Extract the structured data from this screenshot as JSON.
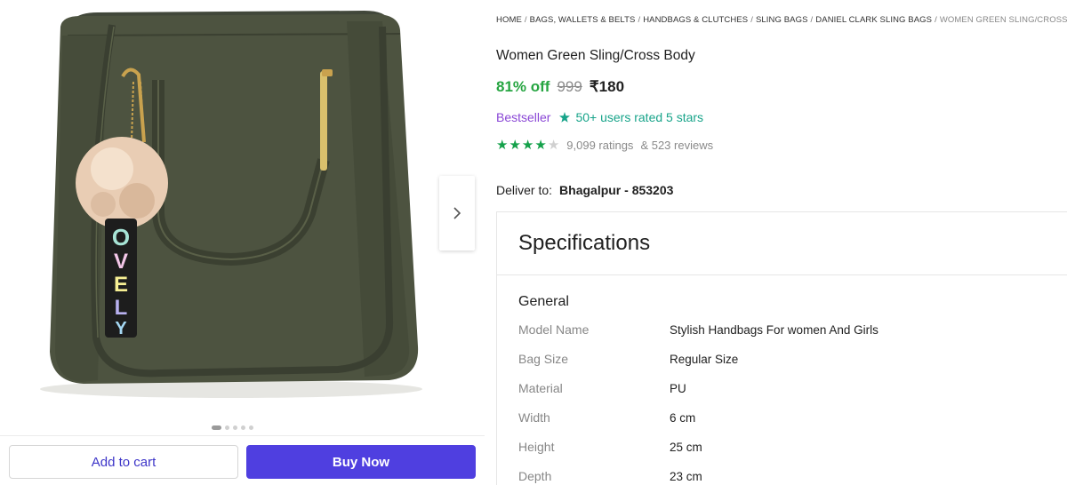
{
  "gallery": {
    "product_image_alt": "Women Green Sling/Cross Body bag",
    "charm_text": "LOVE LY",
    "dot_count": 5,
    "active_dot": 0,
    "colors": {
      "bag": "#4d5340",
      "strap_accent": "#3a3f31",
      "pom": "#e9cdb4"
    }
  },
  "actions": {
    "add_to_cart_label": "Add to cart",
    "buy_now_label": "Buy Now"
  },
  "breadcrumb": {
    "items": [
      "HOME",
      "BAGS, WALLETS & BELTS",
      "HANDBAGS & CLUTCHES",
      "SLING BAGS",
      "DANIEL CLARK SLING BAGS"
    ],
    "current": "WOMEN GREEN SLING/CROSS BO"
  },
  "product": {
    "title": "Women Green Sling/Cross Body",
    "discount": "81% off",
    "mrp": "999",
    "price": "₹180",
    "bestseller": "Bestseller",
    "rated_text": "50+ users rated 5 stars",
    "rating_stars": 4,
    "ratings_count": "9,099 ratings",
    "reviews_count": "& 523 reviews"
  },
  "delivery": {
    "label": "Deliver to:",
    "value": "Bhagalpur - 853203"
  },
  "specifications": {
    "heading": "Specifications",
    "group": "General",
    "rows": [
      {
        "key": "Model Name",
        "value": "Stylish Handbags For women And Girls"
      },
      {
        "key": "Bag Size",
        "value": "Regular Size"
      },
      {
        "key": "Material",
        "value": "PU"
      },
      {
        "key": "Width",
        "value": "6 cm"
      },
      {
        "key": "Height",
        "value": "25 cm"
      },
      {
        "key": "Depth",
        "value": "23 cm"
      }
    ]
  },
  "colors": {
    "discount": "#26a541",
    "buy_now": "#4f3fe0",
    "cart_text": "#3d35c8",
    "bestseller": "#8a47d6",
    "rated": "#18a48a",
    "stars": "#14a14a"
  },
  "icons": {
    "next": "chevron-right-icon",
    "rated_badge": "sparkle-star-icon"
  }
}
